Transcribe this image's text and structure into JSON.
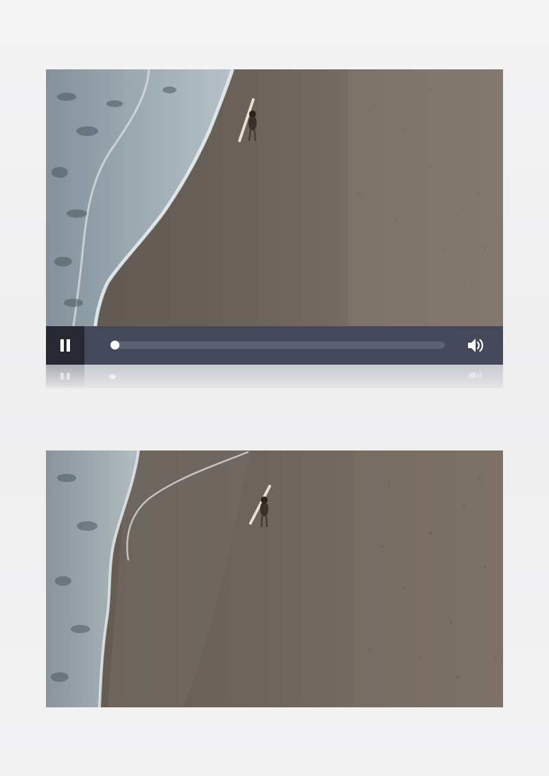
{
  "players": [
    {
      "state": "playing",
      "progress_percent": 0,
      "controls": {
        "play_pause_icon": "pause-icon",
        "volume_icon": "volume-icon"
      },
      "colors": {
        "control_bar": "#454859",
        "play_button_bg": "#262832",
        "track": "#5d6175",
        "knob": "#ffffff"
      }
    },
    {
      "state": "frame-only"
    }
  ]
}
